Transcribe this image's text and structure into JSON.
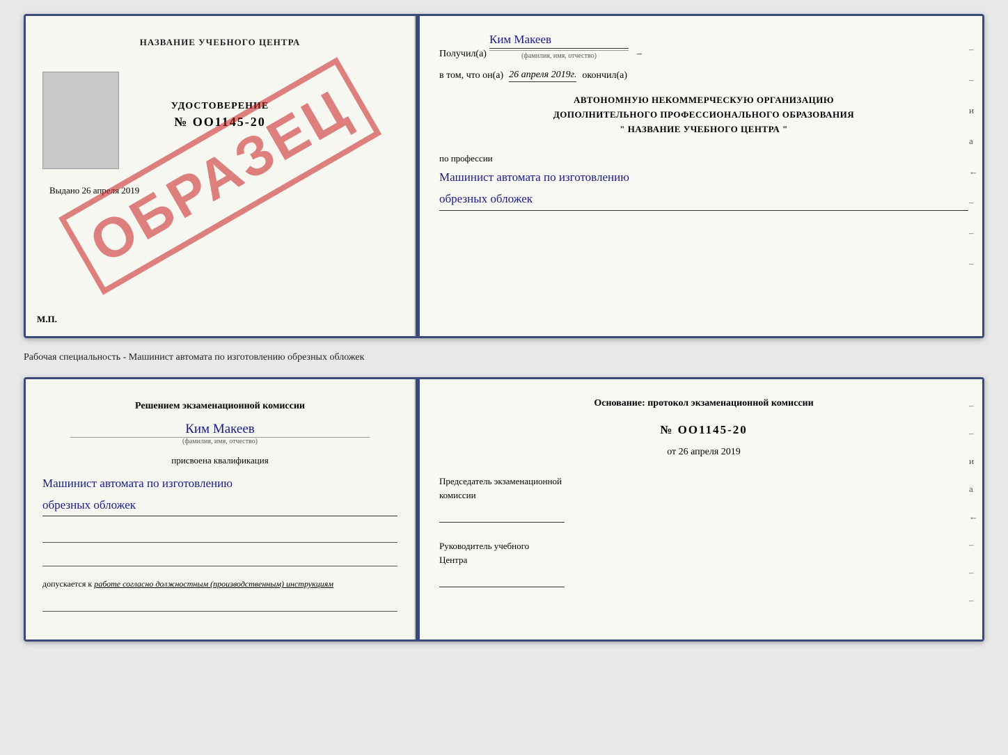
{
  "top_doc": {
    "left": {
      "title": "НАЗВАНИЕ УЧЕБНОГО ЦЕНТРА",
      "cert_label": "УДОСТОВЕРЕНИЕ",
      "cert_number": "№ OO1145-20",
      "issued_prefix": "Выдано",
      "issued_date": "26 апреля 2019",
      "mp_label": "М.П.",
      "watermark": "ОБРАЗЕЦ"
    },
    "right": {
      "recipient_prefix": "Получил(а)",
      "recipient_name": "Ким Макеев",
      "recipient_sublabel": "(фамилия, имя, отчество)",
      "date_prefix": "в том, что он(а)",
      "date_value": "26 апреля 2019г.",
      "date_suffix": "окончил(а)",
      "org_line1": "АВТОНОМНУЮ НЕКОММЕРЧЕСКУЮ ОРГАНИЗАЦИЮ",
      "org_line2": "ДОПОЛНИТЕЛЬНОГО ПРОФЕССИОНАЛЬНОГО ОБРАЗОВАНИЯ",
      "org_line3": "\"   НАЗВАНИЕ УЧЕБНОГО ЦЕНТРА   \"",
      "profession_prefix": "по профессии",
      "profession_line1": "Машинист автомата по изготовлению",
      "profession_line2": "обрезных обложек"
    }
  },
  "caption": "Рабочая специальность - Машинист автомата по изготовлению обрезных обложек",
  "bottom_doc": {
    "left": {
      "commission_title": "Решением экзаменационной комиссии",
      "person_name": "Ким Макеев",
      "person_sublabel": "(фамилия, имя, отчество)",
      "qualification_prefix": "присвоена квалификация",
      "qualification_line1": "Машинист автомата по изготовлению",
      "qualification_line2": "обрезных обложек",
      "допускается_prefix": "допускается к",
      "допускается_text": "работе согласно должностным (производственным) инструкциям"
    },
    "right": {
      "basis_title": "Основание: протокол экзаменационной комиссии",
      "protocol_number": "№ OO1145-20",
      "date_prefix": "от",
      "date_value": "26 апреля 2019",
      "chairman_label1": "Председатель экзаменационной",
      "chairman_label2": "комиссии",
      "director_label1": "Руководитель учебного",
      "director_label2": "Центра"
    }
  },
  "side_marks": [
    "-",
    "–",
    "и",
    "а",
    "←",
    "–",
    "–",
    "–",
    "–"
  ]
}
